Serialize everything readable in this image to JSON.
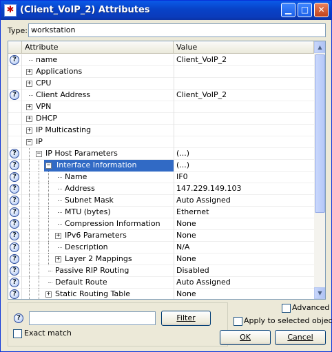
{
  "window": {
    "title": "(Client_VoIP_2) Attributes",
    "icon": "asterisk-app-icon",
    "controls": [
      "minimize",
      "maximize",
      "close"
    ]
  },
  "type_field": {
    "label": "Type:",
    "value": "workstation"
  },
  "grid": {
    "columns": {
      "attribute": "Attribute",
      "value": "Value"
    },
    "rows": [
      {
        "help": true,
        "expander": "",
        "level": 0,
        "label": "name",
        "value": "Client_VoIP_2"
      },
      {
        "help": false,
        "expander": "+",
        "level": 0,
        "label": "Applications",
        "value": ""
      },
      {
        "help": false,
        "expander": "+",
        "level": 0,
        "label": "CPU",
        "value": ""
      },
      {
        "help": true,
        "expander": "",
        "level": 0,
        "label": "Client Address",
        "value": "Client_VoIP_2"
      },
      {
        "help": false,
        "expander": "+",
        "level": 0,
        "label": "VPN",
        "value": ""
      },
      {
        "help": false,
        "expander": "+",
        "level": 0,
        "label": "DHCP",
        "value": ""
      },
      {
        "help": false,
        "expander": "+",
        "level": 0,
        "label": "IP Multicasting",
        "value": ""
      },
      {
        "help": false,
        "expander": "-",
        "level": 0,
        "label": "IP",
        "value": ""
      },
      {
        "help": true,
        "expander": "-",
        "level": 1,
        "label": "IP Host Parameters",
        "value": "(...)"
      },
      {
        "help": true,
        "expander": "-",
        "level": 2,
        "label": "Interface Information",
        "value": "(...)",
        "selected": true
      },
      {
        "help": true,
        "expander": "",
        "level": 3,
        "label": "Name",
        "value": "IF0"
      },
      {
        "help": true,
        "expander": "",
        "level": 3,
        "label": "Address",
        "value": "147.229.149.103"
      },
      {
        "help": true,
        "expander": "",
        "level": 3,
        "label": "Subnet Mask",
        "value": "Auto Assigned"
      },
      {
        "help": true,
        "expander": "",
        "level": 3,
        "label": "MTU (bytes)",
        "value": "Ethernet"
      },
      {
        "help": true,
        "expander": "",
        "level": 3,
        "label": "Compression Information",
        "value": "None"
      },
      {
        "help": true,
        "expander": "+",
        "level": 3,
        "label": "IPv6 Parameters",
        "value": "None"
      },
      {
        "help": true,
        "expander": "",
        "level": 3,
        "label": "Description",
        "value": "N/A"
      },
      {
        "help": true,
        "expander": "+",
        "level": 3,
        "label": "Layer 2 Mappings",
        "value": "None"
      },
      {
        "help": true,
        "expander": "",
        "level": 2,
        "label": "Passive RIP Routing",
        "value": "Disabled"
      },
      {
        "help": true,
        "expander": "",
        "level": 2,
        "label": "Default Route",
        "value": "Auto Assigned"
      },
      {
        "help": true,
        "expander": "+",
        "level": 2,
        "label": "Static Routing Table",
        "value": "None"
      }
    ]
  },
  "filter": {
    "input_value": "",
    "button_label": "Filter",
    "exact_match_label": "Exact match",
    "exact_match_checked": false
  },
  "options": {
    "advanced_label": "Advanced",
    "advanced_checked": false,
    "apply_selected_label": "Apply to selected objects",
    "apply_selected_checked": false
  },
  "buttons": {
    "ok": "OK",
    "cancel": "Cancel"
  },
  "colors": {
    "selection": "#316ac5",
    "titlebar": "#0a5ae8"
  }
}
